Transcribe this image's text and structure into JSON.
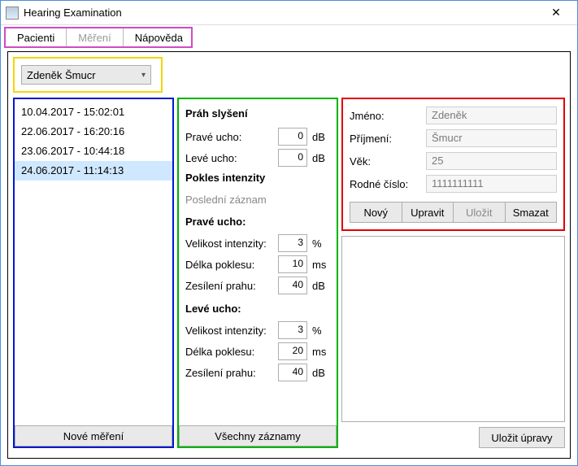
{
  "window": {
    "title": "Hearing Examination",
    "close_glyph": "✕"
  },
  "tabs": {
    "patients": "Pacienti",
    "measurement": "Měření",
    "help": "Nápověda"
  },
  "patient_select": {
    "selected": "Zdeněk Šmucr"
  },
  "records": [
    "10.04.2017 - 15:02:01",
    "22.06.2017 - 16:20:16",
    "23.06.2017 - 10:44:18",
    "24.06.2017 - 11:14:13"
  ],
  "records_selected_index": 3,
  "buttons": {
    "new_measurement": "Nové měření",
    "all_records": "Všechny záznamy",
    "save_edits": "Uložit úpravy",
    "new": "Nový",
    "edit": "Upravit",
    "save": "Uložit",
    "delete": "Smazat"
  },
  "middle": {
    "threshold_heading": "Práh slyšení",
    "right_ear_label": "Pravé ucho:",
    "left_ear_label": "Levé ucho:",
    "right_ear_value": "0",
    "left_ear_value": "0",
    "db_unit": "dB",
    "intensity_decrease_heading": "Pokles intenzity",
    "last_record_label": "Poslední záznam",
    "right_heading": "Pravé ucho:",
    "left_heading": "Levé ucho:",
    "intensity_size_label": "Velikost intenzity:",
    "decrease_length_label": "Délka poklesu:",
    "threshold_gain_label": "Zesílení prahu:",
    "right": {
      "intensity": "3",
      "length": "10",
      "gain": "40"
    },
    "left": {
      "intensity": "3",
      "length": "20",
      "gain": "40"
    },
    "pct_unit": "%",
    "ms_unit": "ms"
  },
  "patient": {
    "first_name_label": "Jméno:",
    "last_name_label": "Příjmení:",
    "age_label": "Věk:",
    "birth_number_label": "Rodné číslo:",
    "first_name": "Zdeněk",
    "last_name": "Šmucr",
    "age": "25",
    "birth_number": "1111111111"
  }
}
